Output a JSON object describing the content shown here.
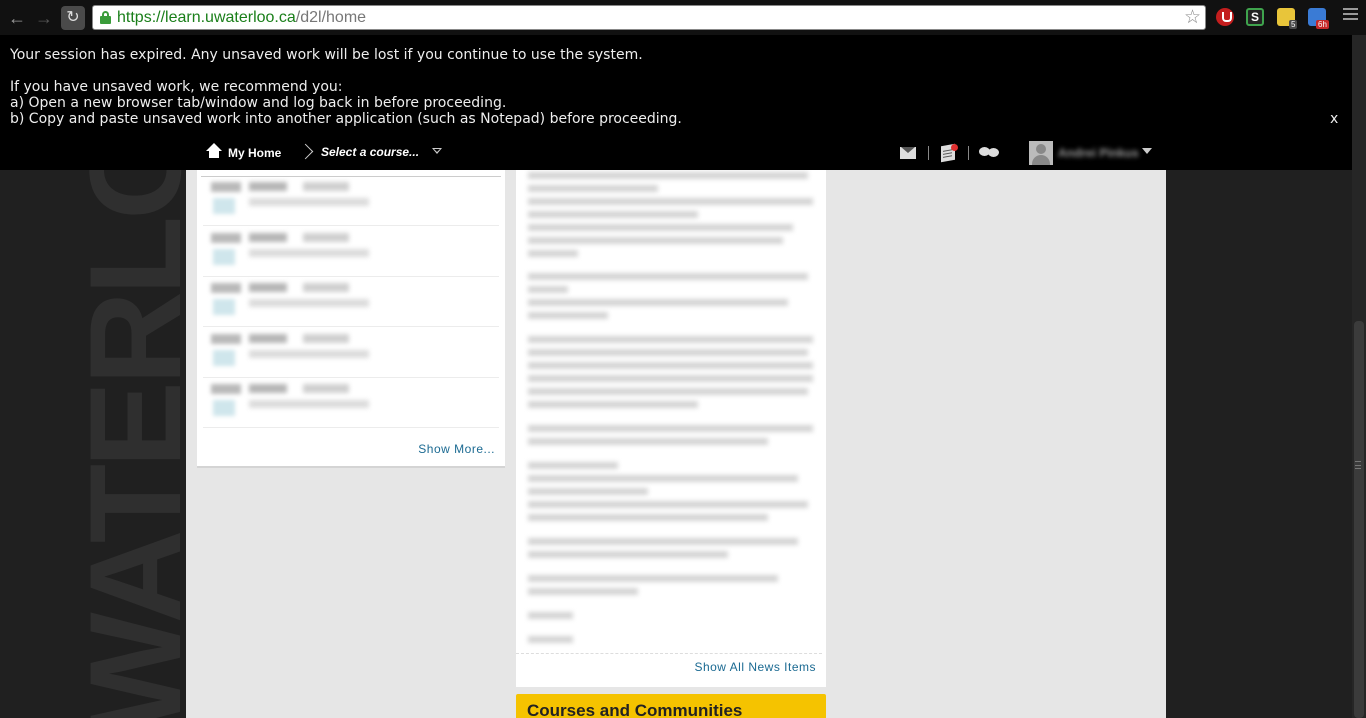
{
  "browser": {
    "url_scheme": "https://",
    "url_host": "learn.uwaterloo.ca",
    "url_path": "/d2l/home",
    "extensions": [
      {
        "name": "adblock-icon"
      },
      {
        "name": "s-extension-icon",
        "label": "S"
      },
      {
        "name": "notes-extension-icon",
        "badge": "5"
      },
      {
        "name": "calendar-extension-icon",
        "badge": "6h"
      }
    ]
  },
  "session_banner": {
    "line1": "Your session has expired. Any unsaved work will be lost if you continue to use the system.",
    "line2": "If you have unsaved work, we recommend you:",
    "line3": "a) Open a new browser tab/window and log back in before proceeding.",
    "line4": "b) Copy and paste unsaved work into another application (such as Notepad) before proceeding.",
    "close": "x"
  },
  "navbar": {
    "home_label": "My Home",
    "select_course": "Select a course...",
    "user_name": "Andrei Pinkus"
  },
  "watermark": "WATERLOO",
  "calendar_widget": {
    "show_more": "Show More..."
  },
  "news_widget": {
    "show_all": "Show All News Items"
  },
  "courses_widget": {
    "title": "Courses and Communities"
  },
  "colors": {
    "accent_link": "#1b6a92",
    "courses_header": "#f5c300",
    "banner_bg": "#000000"
  }
}
